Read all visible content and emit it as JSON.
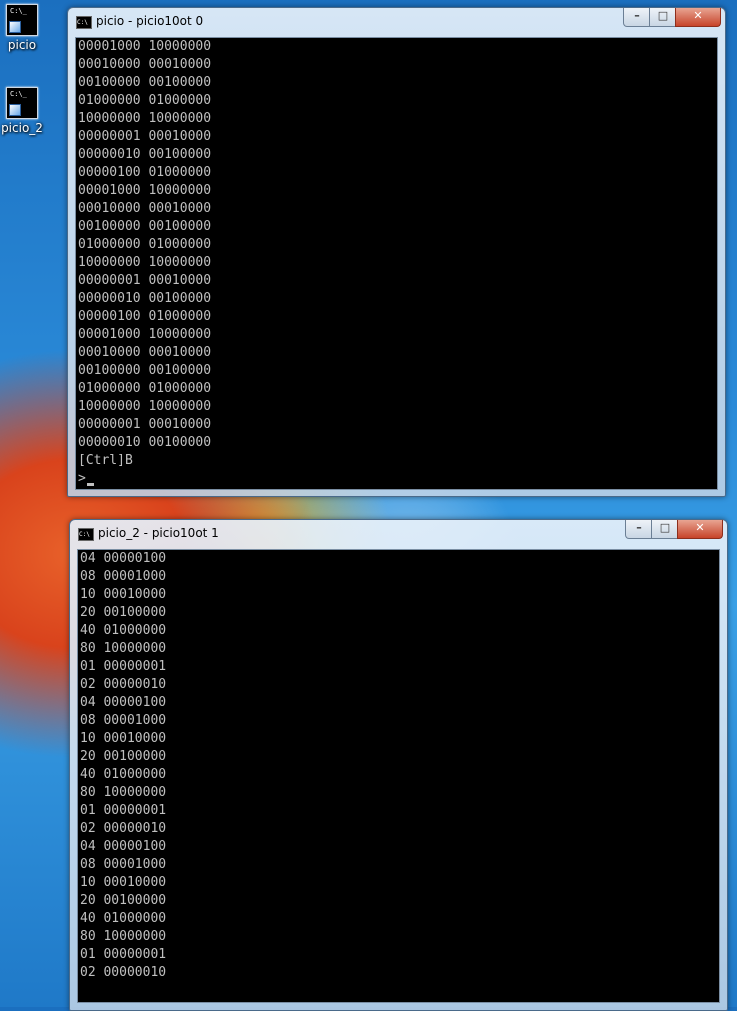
{
  "desktop": {
    "icons": [
      {
        "label": "picio",
        "glyph": "C:\\_"
      },
      {
        "label": "picio_2",
        "glyph": "C:\\_"
      }
    ]
  },
  "windows": [
    {
      "title": "picio - picio10ot  0",
      "icon_glyph": "C:\\",
      "controls": {
        "minimize": "–",
        "maximize": "□",
        "close": "✕"
      },
      "lines": [
        "00001000 10000000",
        "00010000 00010000",
        "00100000 00100000",
        "01000000 01000000",
        "10000000 10000000",
        "00000001 00010000",
        "00000010 00100000",
        "00000100 01000000",
        "00001000 10000000",
        "00010000 00010000",
        "00100000 00100000",
        "01000000 01000000",
        "10000000 10000000",
        "00000001 00010000",
        "00000010 00100000",
        "00000100 01000000",
        "00001000 10000000",
        "00010000 00010000",
        "00100000 00100000",
        "01000000 01000000",
        "10000000 10000000",
        "00000001 00010000",
        "00000010 00100000",
        "[Ctrl]B"
      ],
      "prompt": ">"
    },
    {
      "title": "picio_2 - picio10ot  1",
      "icon_glyph": "C:\\",
      "controls": {
        "minimize": "–",
        "maximize": "□",
        "close": "✕"
      },
      "lines": [
        "04 00000100",
        "08 00001000",
        "10 00010000",
        "20 00100000",
        "40 01000000",
        "80 10000000",
        "01 00000001",
        "02 00000010",
        "04 00000100",
        "08 00001000",
        "10 00010000",
        "20 00100000",
        "40 01000000",
        "80 10000000",
        "01 00000001",
        "02 00000010",
        "04 00000100",
        "08 00001000",
        "10 00010000",
        "20 00100000",
        "40 01000000",
        "80 10000000",
        "01 00000001",
        "02 00000010"
      ]
    }
  ]
}
